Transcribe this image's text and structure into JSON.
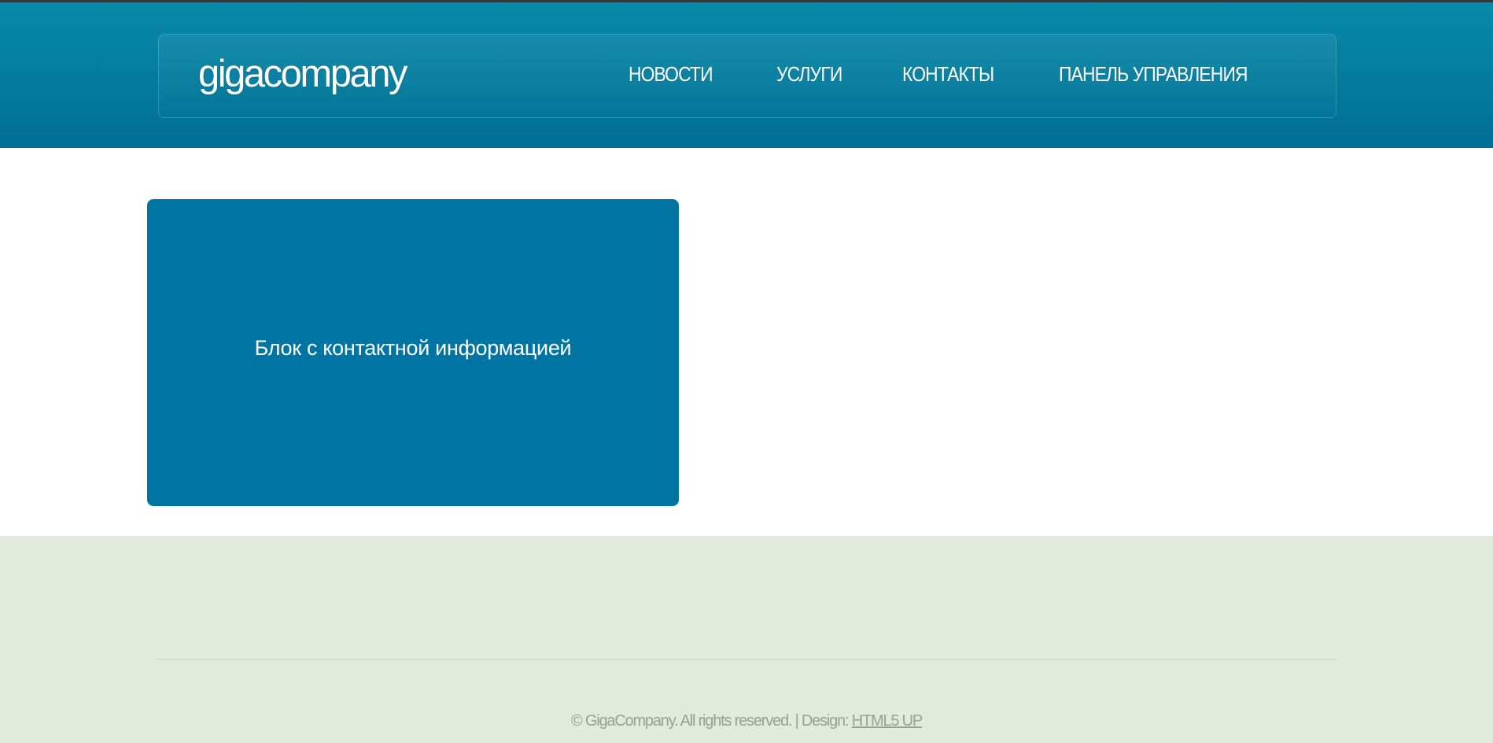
{
  "header": {
    "logo": "gigacompany",
    "nav": [
      {
        "label": "НОВОСТИ"
      },
      {
        "label": "УСЛУГИ"
      },
      {
        "label": "КОНТАКТЫ"
      },
      {
        "label": "ПАНЕЛЬ УПРАВЛЕНИЯ"
      }
    ]
  },
  "main": {
    "contact_block_text": "Блок с контактной информацией"
  },
  "footer": {
    "copyright": "© GigaCompany. All rights reserved. | Design: ",
    "design_link": "HTML5 UP"
  },
  "colors": {
    "header": "#0889a8",
    "contact_block": "#0075a3",
    "footer": "#e2e9dd"
  }
}
